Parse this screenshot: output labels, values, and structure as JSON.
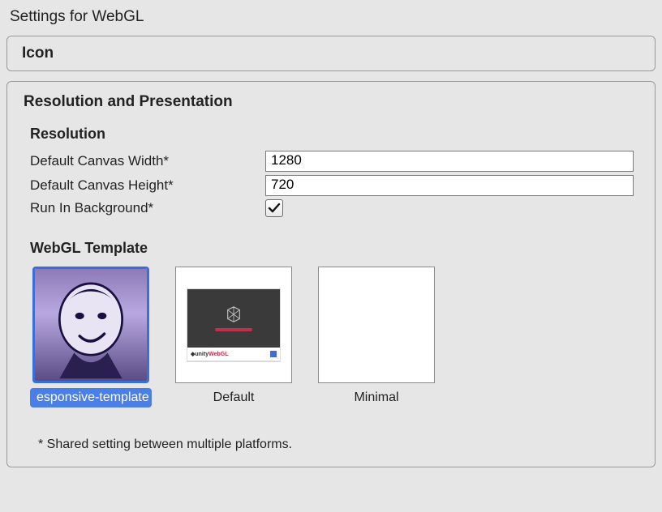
{
  "page_title": "Settings for WebGL",
  "sections": {
    "icon": {
      "title": "Icon"
    },
    "resolution_presentation": {
      "title": "Resolution and Presentation",
      "resolution_header": "Resolution",
      "default_canvas_width_label": "Default Canvas Width*",
      "default_canvas_width_value": "1280",
      "default_canvas_height_label": "Default Canvas Height*",
      "default_canvas_height_value": "720",
      "run_in_background_label": "Run In Background*",
      "run_in_background_checked": true,
      "webgl_template_header": "WebGL Template",
      "templates": [
        {
          "id": "responsive-template",
          "label": "esponsive-template",
          "selected": true
        },
        {
          "id": "default",
          "label": "Default",
          "selected": false
        },
        {
          "id": "minimal",
          "label": "Minimal",
          "selected": false
        }
      ],
      "footnote": "* Shared setting between multiple platforms."
    }
  }
}
